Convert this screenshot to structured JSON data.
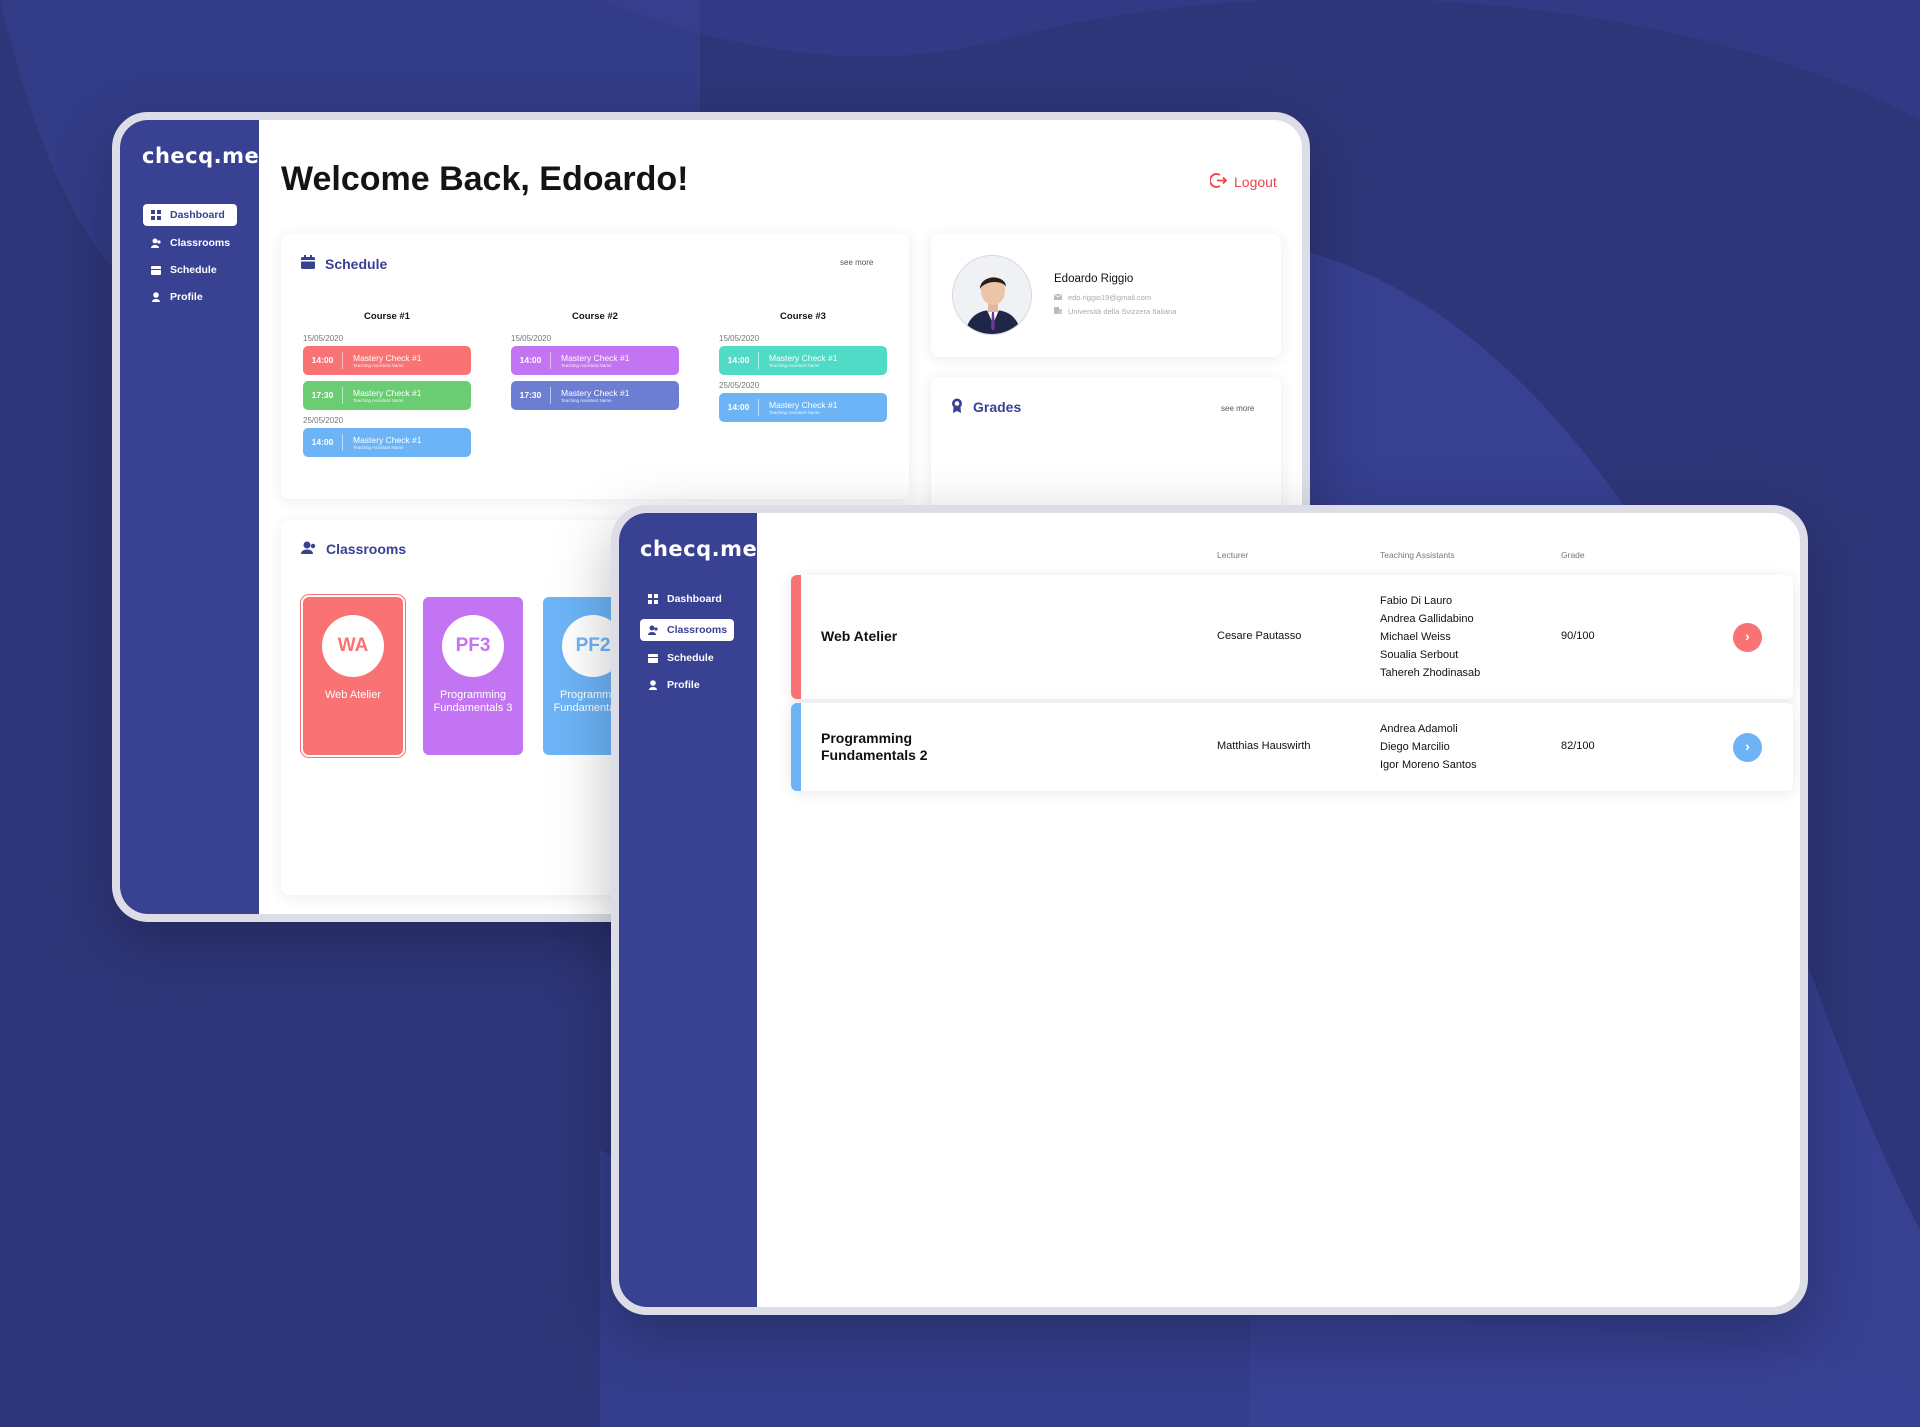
{
  "colors": {
    "background": "#2e3679",
    "sidebar": "#394193",
    "accent": "#394193",
    "logout": "#f0454b",
    "red": "#f97274",
    "green": "#6acd73",
    "purple": "#c374f2",
    "indigo": "#6b7ed1",
    "teal": "#4fdbc5",
    "blue": "#6db4f7"
  },
  "app": {
    "logo": "checq.me"
  },
  "nav": [
    {
      "label": "Dashboard",
      "icon": "dashboard-icon"
    },
    {
      "label": "Classrooms",
      "icon": "classrooms-icon"
    },
    {
      "label": "Schedule",
      "icon": "calendar-icon"
    },
    {
      "label": "Profile",
      "icon": "profile-icon"
    }
  ],
  "dashboard": {
    "welcome": "Welcome Back, Edoardo!",
    "logout": "Logout",
    "schedule": {
      "title": "Schedule",
      "see_more": "see more",
      "courses": [
        {
          "name": "Course #1",
          "groups": [
            {
              "date": "15/05/2020",
              "slots": [
                {
                  "time": "14:00",
                  "title": "Mastery Check #1",
                  "sub": "Teaching Assistant Name",
                  "color": "#f97274"
                },
                {
                  "time": "17:30",
                  "title": "Mastery Check #1",
                  "sub": "Teaching Assistant Name",
                  "color": "#6acd73"
                }
              ]
            },
            {
              "date": "25/05/2020",
              "slots": [
                {
                  "time": "14:00",
                  "title": "Mastery Check #1",
                  "sub": "Teaching Assistant Name",
                  "color": "#6db4f7"
                }
              ]
            }
          ]
        },
        {
          "name": "Course #2",
          "groups": [
            {
              "date": "15/05/2020",
              "slots": [
                {
                  "time": "14:00",
                  "title": "Mastery Check #1",
                  "sub": "Teaching Assistant Name",
                  "color": "#c374f2"
                },
                {
                  "time": "17:30",
                  "title": "Mastery Check #1",
                  "sub": "Teaching Assistant Name",
                  "color": "#6b7ed1"
                }
              ]
            }
          ]
        },
        {
          "name": "Course #3",
          "groups": [
            {
              "date": "15/05/2020",
              "slots": [
                {
                  "time": "14:00",
                  "title": "Mastery Check #1",
                  "sub": "Teaching Assistant Name",
                  "color": "#4fdbc5"
                }
              ]
            },
            {
              "date": "25/05/2020",
              "slots": [
                {
                  "time": "14:00",
                  "title": "Mastery Check #1",
                  "sub": "Teaching Assistant Name",
                  "color": "#6db4f7"
                }
              ]
            }
          ]
        }
      ]
    },
    "profile": {
      "name": "Edoardo Riggio",
      "email": "edo.riggio19@gmail.com",
      "university": "Università della Svizzera Italiana"
    },
    "grades": {
      "title": "Grades",
      "see_more": "see more"
    },
    "classrooms": {
      "title": "Classrooms",
      "cards": [
        {
          "abbr": "WA",
          "name": "Web Atelier",
          "color": "#f97274"
        },
        {
          "abbr": "PF3",
          "name": "Programming Fundamentals 3",
          "color": "#c374f2"
        },
        {
          "abbr": "PF2",
          "name": "Programming Fundamentals 2",
          "color": "#6db4f7"
        }
      ]
    }
  },
  "classrooms_page": {
    "headers": {
      "lecturer": "Lecturer",
      "tas": "Teaching Assistants",
      "grade": "Grade"
    },
    "rows": [
      {
        "name": "Web Atelier",
        "lecturer": "Cesare Pautasso",
        "tas": [
          "Fabio Di Lauro",
          "Andrea Gallidabino",
          "Michael Weiss",
          "Soualia Serbout",
          "Tahereh Zhodinasab"
        ],
        "grade": "90/100",
        "color": "#f97274"
      },
      {
        "name": "Programming Fundamentals 2",
        "lecturer": "Matthias Hauswirth",
        "tas": [
          "Andrea Adamoli",
          "Diego Marcilio",
          "Igor Moreno Santos"
        ],
        "grade": "82/100",
        "color": "#6db4f7"
      }
    ]
  }
}
